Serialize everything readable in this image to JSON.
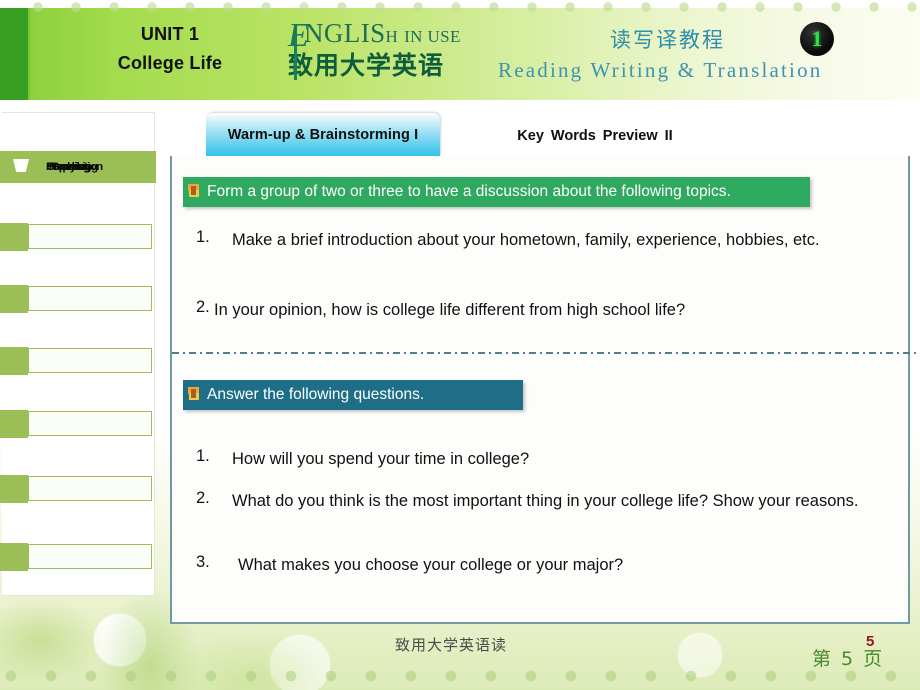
{
  "header": {
    "unit_line1": "UNIT 1",
    "unit_line2": "College Life",
    "logo_e": "E",
    "logo_en_rest": "NGLI",
    "logo_en_sh": "S",
    "logo_en_h": "H",
    "logo_en_inuse": "IN USE",
    "logo_cn": "致用大学英语",
    "course_cn": "读写译教程",
    "course_en": "Reading  Writing  &  Translation",
    "unit_badge": "1",
    "accent_green": "#7cc832",
    "accent_darkgreen": "#37a023",
    "accent_teal": "#2f8ea8"
  },
  "sidebar": {
    "head_icon": "cup-icon",
    "head_labels": [
      "Preparation",
      "Reading",
      "Speaking",
      "Studying"
    ],
    "items": [
      {
        "label": ""
      },
      {
        "label": ""
      },
      {
        "label": ""
      },
      {
        "label": ""
      },
      {
        "label": ""
      },
      {
        "label": ""
      }
    ]
  },
  "tabs": {
    "active": "Warm-up & Brainstorming I",
    "inactive": "Key  Words  Preview  II",
    "active_color": "#45c8ea"
  },
  "main": {
    "banner1": {
      "text": "Form a group of two or three to have a discussion about the following topics.",
      "color": "#2fa860",
      "icon": "note-icon"
    },
    "topics": [
      {
        "num": "1.",
        "text": "Make a brief introduction about your hometown, family, experience, hobbies, etc."
      },
      {
        "num": "2.",
        "text": "In your opinion, how is college life different from high school life?"
      }
    ],
    "banner2": {
      "text": "Answer the following questions.",
      "color": "#1d6e86",
      "icon": "note-icon"
    },
    "questions": [
      {
        "num": "1.",
        "text": "How will you spend your time in college?"
      },
      {
        "num": "2.",
        "text": "What do you think is the most important thing in your college life? Show your reasons."
      },
      {
        "num": "3.",
        "text": "What makes you choose your college or your major?"
      }
    ]
  },
  "footer": {
    "book_cn": "致用大学英语读",
    "page_number_overlay": "5",
    "page_label": "第 5 页",
    "page_label_color": "#4b8a2e"
  }
}
